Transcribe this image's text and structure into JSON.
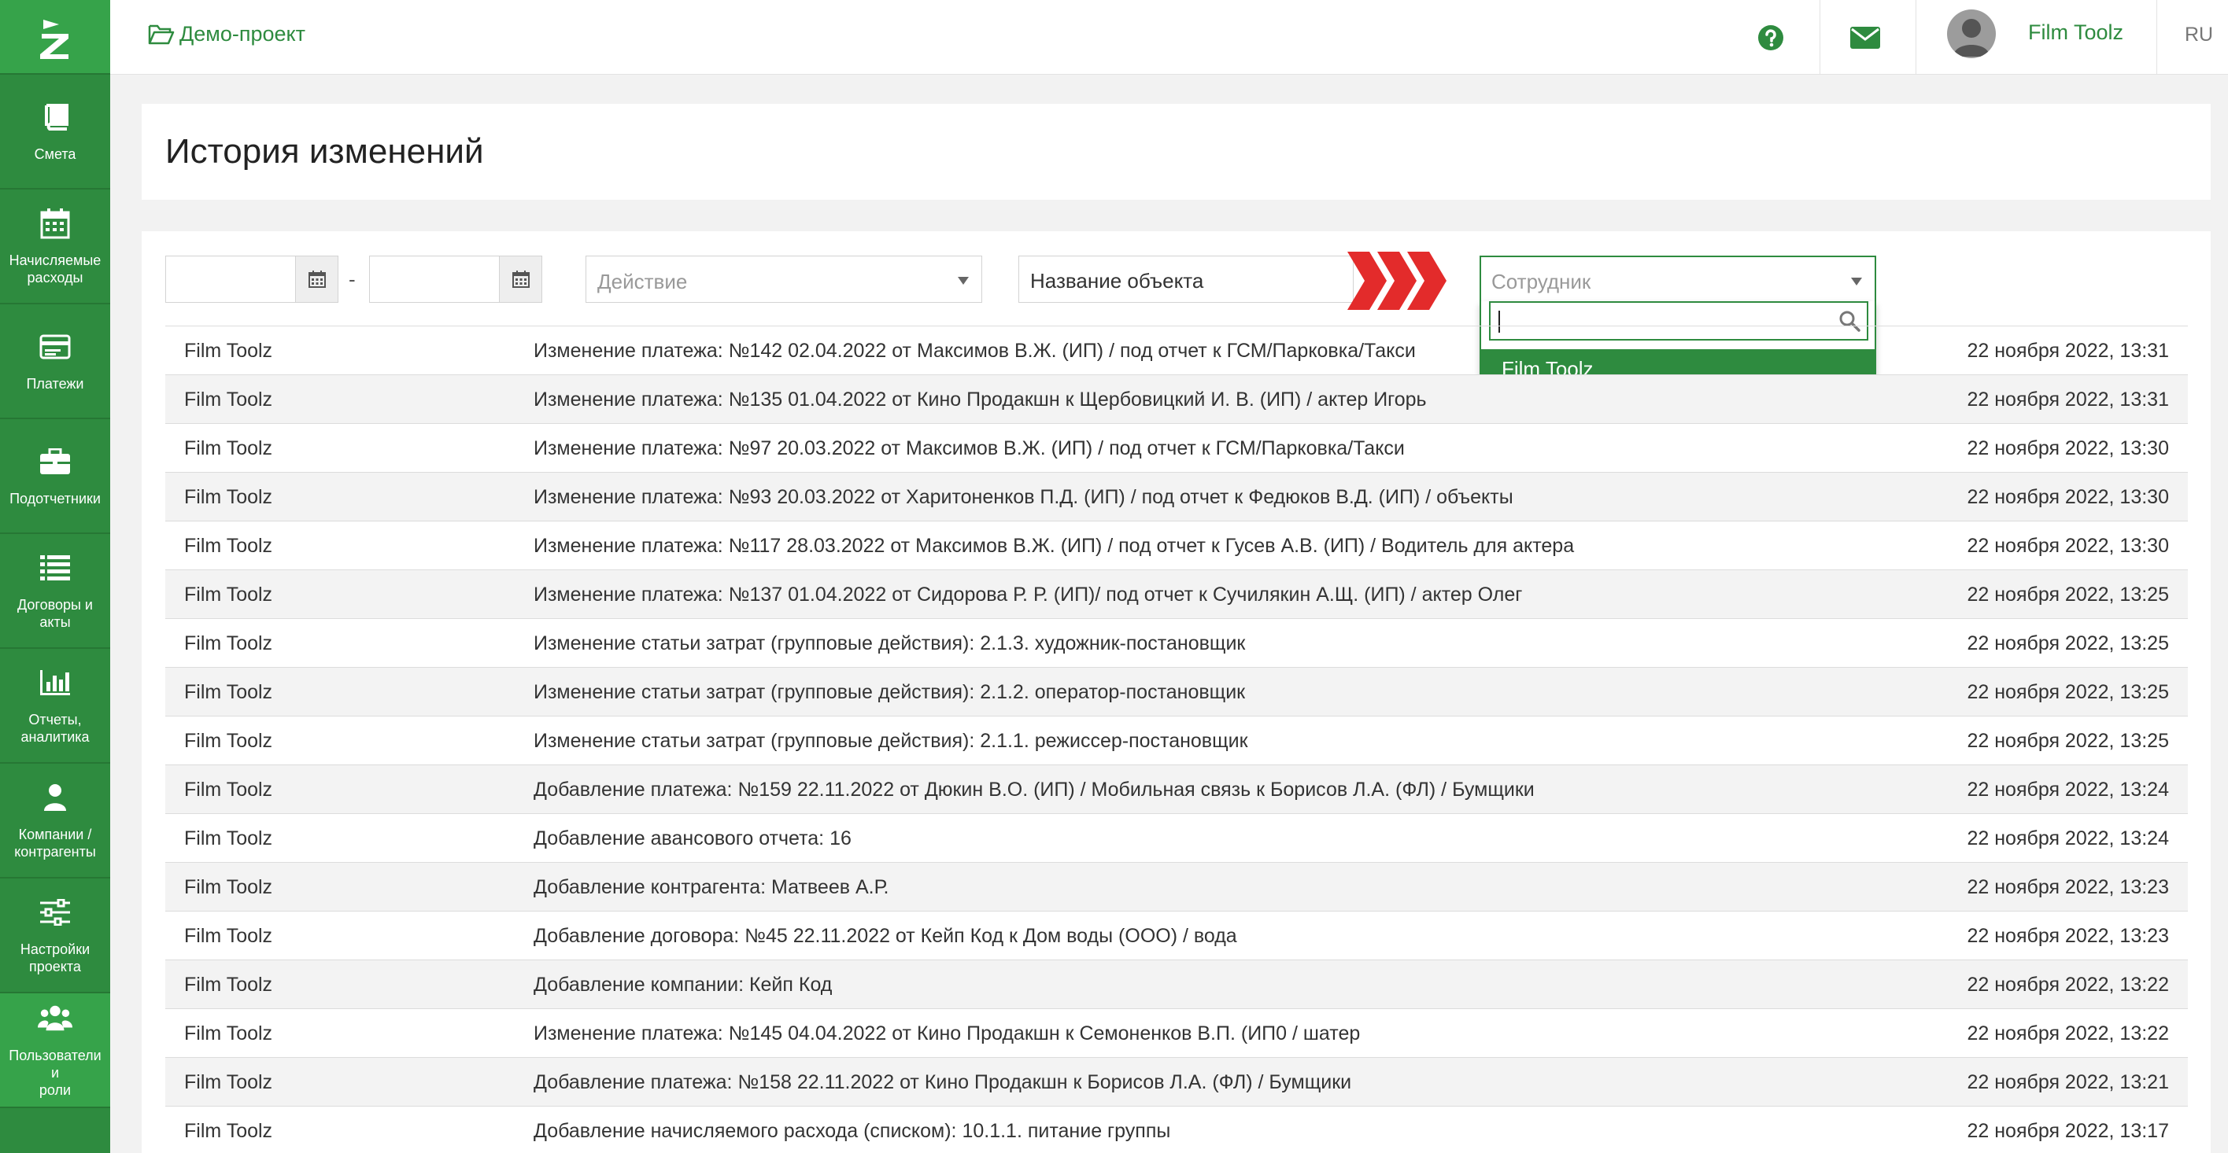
{
  "app": {
    "brand_color": "#2e8b3f",
    "accent_red": "#e32b2b"
  },
  "sidebar": {
    "items": [
      {
        "label": "Смета",
        "icon": "book-icon"
      },
      {
        "label": "Начисляемые\nрасходы",
        "icon": "calendar-icon"
      },
      {
        "label": "Платежи",
        "icon": "credit-card-icon"
      },
      {
        "label": "Подотчетники",
        "icon": "briefcase-icon"
      },
      {
        "label": "Договоры и\nакты",
        "icon": "list-icon"
      },
      {
        "label": "Отчеты,\nаналитика",
        "icon": "bar-chart-icon"
      },
      {
        "label": "Компании /\nконтрагенты",
        "icon": "user-icon"
      },
      {
        "label": "Настройки\nпроекта",
        "icon": "sliders-icon"
      },
      {
        "label": "Пользователи и\nроли",
        "icon": "users-icon"
      }
    ]
  },
  "header": {
    "project_name": "Демо-проект",
    "user_name": "Film Toolz",
    "language": "RU"
  },
  "page": {
    "title": "История изменений"
  },
  "filters": {
    "date_from": "",
    "date_to": "",
    "date_separator": "-",
    "action_placeholder": "Действие",
    "object_name_value": "Название объекта",
    "employee_placeholder": "Сотрудник",
    "employee_search_value": "",
    "employee_options": [
      "Film Toolz"
    ]
  },
  "table": {
    "rows": [
      {
        "user": "Film Toolz",
        "action": "Изменение платежа: №142 02.04.2022 от Максимов В.Ж. (ИП) / под отчет к ГСМ/Парковка/Такси",
        "time": "22 ноября 2022, 13:31"
      },
      {
        "user": "Film Toolz",
        "action": "Изменение платежа: №135 01.04.2022 от Кино Продакшн к Щербовицкий И. В. (ИП) / актер Игорь",
        "time": "22 ноября 2022, 13:31"
      },
      {
        "user": "Film Toolz",
        "action": "Изменение платежа: №97 20.03.2022 от Максимов В.Ж. (ИП) / под отчет к ГСМ/Парковка/Такси",
        "time": "22 ноября 2022, 13:30"
      },
      {
        "user": "Film Toolz",
        "action": "Изменение платежа: №93 20.03.2022 от Харитоненков П.Д. (ИП) / под отчет к Федюков В.Д. (ИП) / объекты",
        "time": "22 ноября 2022, 13:30"
      },
      {
        "user": "Film Toolz",
        "action": "Изменение платежа: №117 28.03.2022 от Максимов В.Ж. (ИП) / под отчет к Гусев А.В. (ИП) / Водитель для актера",
        "time": "22 ноября 2022, 13:30"
      },
      {
        "user": "Film Toolz",
        "action": "Изменение платежа: №137 01.04.2022 от Сидорова Р. Р. (ИП)/ под отчет к Сучилякин А.Щ. (ИП) / актер Олег",
        "time": "22 ноября 2022, 13:25"
      },
      {
        "user": "Film Toolz",
        "action": "Изменение статьи затрат (групповые действия): 2.1.3. художник-постановщик",
        "time": "22 ноября 2022, 13:25"
      },
      {
        "user": "Film Toolz",
        "action": "Изменение статьи затрат (групповые действия): 2.1.2. оператор-постановщик",
        "time": "22 ноября 2022, 13:25"
      },
      {
        "user": "Film Toolz",
        "action": "Изменение статьи затрат (групповые действия): 2.1.1. режиссер-постановщик",
        "time": "22 ноября 2022, 13:25"
      },
      {
        "user": "Film Toolz",
        "action": "Добавление платежа: №159 22.11.2022 от Дюкин В.О. (ИП) / Мобильная связь к Борисов Л.А. (ФЛ) / Бумщики",
        "time": "22 ноября 2022, 13:24"
      },
      {
        "user": "Film Toolz",
        "action": "Добавление авансового отчета: 16",
        "time": "22 ноября 2022, 13:24"
      },
      {
        "user": "Film Toolz",
        "action": "Добавление контрагента: Матвеев А.Р.",
        "time": "22 ноября 2022, 13:23"
      },
      {
        "user": "Film Toolz",
        "action": "Добавление договора: №45 22.11.2022 от Кейп Код к Дом воды (ООО) / вода",
        "time": "22 ноября 2022, 13:23"
      },
      {
        "user": "Film Toolz",
        "action": "Добавление компании: Кейп Код",
        "time": "22 ноября 2022, 13:22"
      },
      {
        "user": "Film Toolz",
        "action": "Изменение платежа: №145 04.04.2022 от Кино Продакшн к Семоненков В.П. (ИП0 / шатер",
        "time": "22 ноября 2022, 13:22"
      },
      {
        "user": "Film Toolz",
        "action": "Добавление платежа: №158 22.11.2022 от Кино Продакшн к Борисов Л.А. (ФЛ) / Бумщики",
        "time": "22 ноября 2022, 13:21"
      },
      {
        "user": "Film Toolz",
        "action": "Добавление начисляемого расхода (списком): 10.1.1. питание группы",
        "time": "22 ноября 2022, 13:17"
      }
    ]
  }
}
